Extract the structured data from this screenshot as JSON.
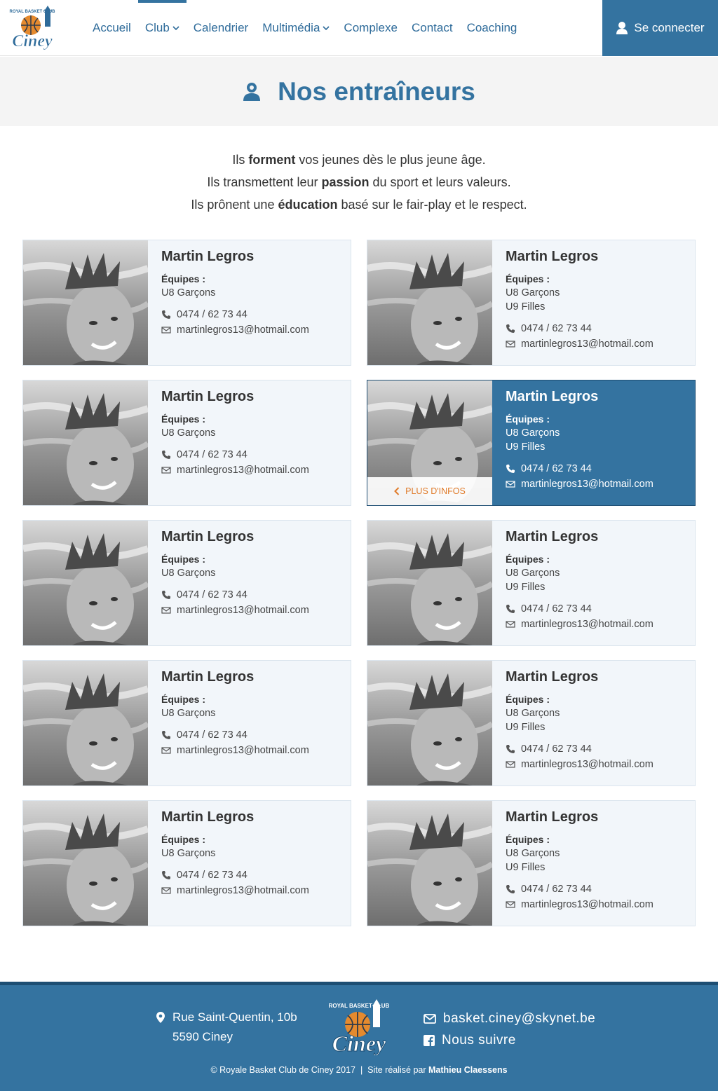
{
  "header": {
    "logo_alt": "Royal Basket Club Ciney",
    "logo_top": "ROYAL BASKET CLUB",
    "logo_word": "Ciney",
    "nav": [
      {
        "label": "Accueil",
        "dropdown": false,
        "active": false
      },
      {
        "label": "Club",
        "dropdown": true,
        "active": true
      },
      {
        "label": "Calendrier",
        "dropdown": false,
        "active": false
      },
      {
        "label": "Multimédia",
        "dropdown": true,
        "active": false
      },
      {
        "label": "Complexe",
        "dropdown": false,
        "active": false
      },
      {
        "label": "Contact",
        "dropdown": false,
        "active": false
      },
      {
        "label": "Coaching",
        "dropdown": false,
        "active": false
      }
    ],
    "login_label": "Se connecter"
  },
  "page": {
    "title": "Nos entraîneurs",
    "intro": [
      {
        "before": "Ils ",
        "bold": "forment",
        "after": " vos jeunes dès le plus jeune âge."
      },
      {
        "before": "Ils  transmettent leur ",
        "bold": "passion",
        "after": " du sport et leurs valeurs."
      },
      {
        "before": "Ils prônent une ",
        "bold": "éducation",
        "after": " basé sur le fair-play et le respect."
      }
    ]
  },
  "coaches": [
    {
      "name": "Martin Legros",
      "teams_label": "Équipes :",
      "teams": [
        "U8 Garçons"
      ],
      "phone": "0474 / 62 73 44",
      "email": "martinlegros13@hotmail.com",
      "highlight": false
    },
    {
      "name": "Martin Legros",
      "teams_label": "Équipes :",
      "teams": [
        "U8 Garçons",
        "U9 Filles"
      ],
      "phone": "0474 / 62 73 44",
      "email": "martinlegros13@hotmail.com",
      "highlight": false
    },
    {
      "name": "Martin Legros",
      "teams_label": "Équipes :",
      "teams": [
        "U8 Garçons"
      ],
      "phone": "0474 / 62 73 44",
      "email": "martinlegros13@hotmail.com",
      "highlight": false
    },
    {
      "name": "Martin Legros",
      "teams_label": "Équipes :",
      "teams": [
        "U8 Garçons",
        "U9 Filles"
      ],
      "phone": "0474 / 62 73 44",
      "email": "martinlegros13@hotmail.com",
      "highlight": true,
      "more_label": "Plus d'infos"
    },
    {
      "name": "Martin Legros",
      "teams_label": "Équipes :",
      "teams": [
        "U8 Garçons"
      ],
      "phone": "0474 / 62 73 44",
      "email": "martinlegros13@hotmail.com",
      "highlight": false
    },
    {
      "name": "Martin Legros",
      "teams_label": "Équipes :",
      "teams": [
        "U8 Garçons",
        "U9 Filles"
      ],
      "phone": "0474 / 62 73 44",
      "email": "martinlegros13@hotmail.com",
      "highlight": false
    },
    {
      "name": "Martin Legros",
      "teams_label": "Équipes :",
      "teams": [
        "U8 Garçons"
      ],
      "phone": "0474 / 62 73 44",
      "email": "martinlegros13@hotmail.com",
      "highlight": false
    },
    {
      "name": "Martin Legros",
      "teams_label": "Équipes :",
      "teams": [
        "U8 Garçons",
        "U9 Filles"
      ],
      "phone": "0474 / 62 73 44",
      "email": "martinlegros13@hotmail.com",
      "highlight": false
    },
    {
      "name": "Martin Legros",
      "teams_label": "Équipes :",
      "teams": [
        "U8 Garçons"
      ],
      "phone": "0474 / 62 73 44",
      "email": "martinlegros13@hotmail.com",
      "highlight": false
    },
    {
      "name": "Martin Legros",
      "teams_label": "Équipes :",
      "teams": [
        "U8 Garçons",
        "U9 Filles"
      ],
      "phone": "0474 / 62 73 44",
      "email": "martinlegros13@hotmail.com",
      "highlight": false
    }
  ],
  "footer": {
    "address_line1": "Rue Saint-Quentin, 10b",
    "address_line2": "5590 Ciney",
    "email": "basket.ciney@skynet.be",
    "follow_label": "Nous suivre",
    "copyright": "© Royale Basket Club de Ciney 2017",
    "separator": "|",
    "credit_prefix": "Site réalisé par",
    "credit_name": "Mathieu Claessens"
  },
  "colors": {
    "brand_blue": "#3473a0",
    "accent_orange": "#e07b2a",
    "card_bg": "#f2f6fa"
  }
}
